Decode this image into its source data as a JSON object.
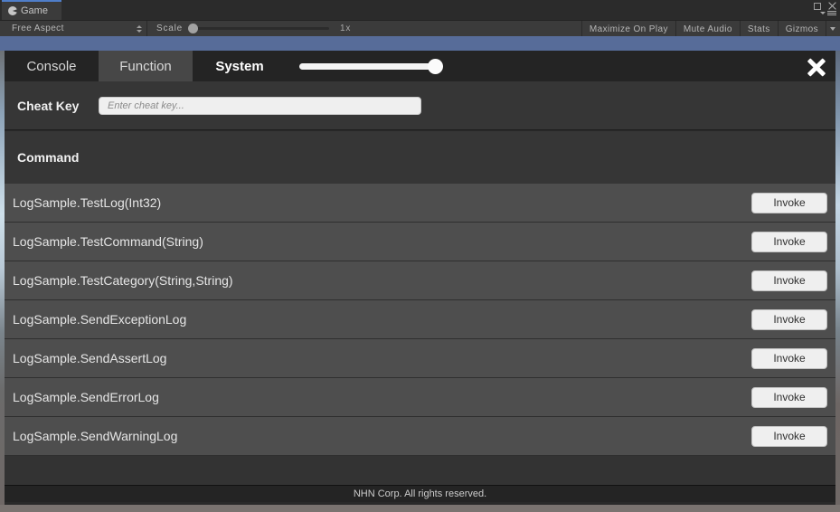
{
  "editor": {
    "tab_label": "Game",
    "tab_icon": "unity-game-view-icon",
    "window_restore_icon": "restore-window-icon",
    "window_close_icon": "close-window-icon",
    "window_menu_icon": "window-menu-icon",
    "toolbar": {
      "aspect_value": "Free Aspect",
      "aspect_dropdown_icon": "updown-arrows-icon",
      "scale_label": "Scale",
      "scale_value": "1x",
      "buttons": [
        {
          "label": "Maximize On Play"
        },
        {
          "label": "Mute Audio"
        },
        {
          "label": "Stats"
        },
        {
          "label": "Gizmos"
        }
      ],
      "gizmos_dropdown_icon": "chevron-down-icon"
    }
  },
  "panel": {
    "tabs": [
      {
        "label": "Console",
        "state": "normal"
      },
      {
        "label": "Function",
        "state": "selected"
      },
      {
        "label": "System",
        "state": "active"
      }
    ],
    "opacity_slider": {
      "name": "opacity-slider",
      "value": 90
    },
    "close_icon": "close-icon",
    "cheat": {
      "label": "Cheat Key",
      "input_value": "",
      "input_placeholder": "Enter cheat key..."
    },
    "command_header": "Command",
    "commands": [
      {
        "name": "LogSample.TestLog(Int32)",
        "action": "Invoke"
      },
      {
        "name": "LogSample.TestCommand(String)",
        "action": "Invoke"
      },
      {
        "name": "LogSample.TestCategory(String,String)",
        "action": "Invoke"
      },
      {
        "name": "LogSample.SendExceptionLog",
        "action": "Invoke"
      },
      {
        "name": "LogSample.SendAssertLog",
        "action": "Invoke"
      },
      {
        "name": "LogSample.SendErrorLog",
        "action": "Invoke"
      },
      {
        "name": "LogSample.SendWarningLog",
        "action": "Invoke"
      }
    ],
    "footer": "NHN Corp. All rights reserved."
  },
  "colors": {
    "accent_blue": "#576c99",
    "panel_bg": "#333333",
    "row_bg": "#4e4e4e",
    "tabbar_bg": "#242424",
    "button_bg": "#efefef"
  }
}
